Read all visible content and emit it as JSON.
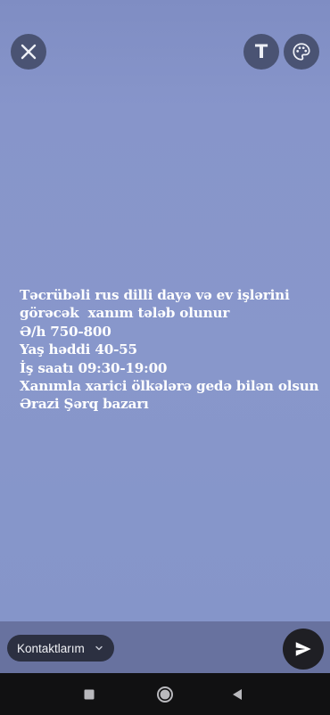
{
  "toolbar": {
    "close_icon": "close-icon",
    "text_tool_glyph": "T",
    "palette_icon": "palette-icon"
  },
  "story": {
    "lines": [
      "Təcrübəli rus dilli dayə və ev işlərini",
      "görəcək  xanım tələb olunur",
      "Ə/h 750-800",
      "Yaş həddi 40-55",
      "İş saatı 09:30-19:00",
      "Xanımla xarici ölkələrə gedə bilən olsun",
      "Ərazi Şərq bazarı"
    ]
  },
  "audience": {
    "label": "Kontaktlarım",
    "chevron_icon": "chevron-down-icon"
  },
  "send": {
    "icon": "send-icon"
  },
  "system_nav": {
    "recent_icon": "recent-apps-icon",
    "home_icon": "home-icon",
    "back_icon": "back-icon"
  },
  "colors": {
    "background": "#8595c9",
    "bottom_bar": "#68729f",
    "text": "#ffffff"
  }
}
